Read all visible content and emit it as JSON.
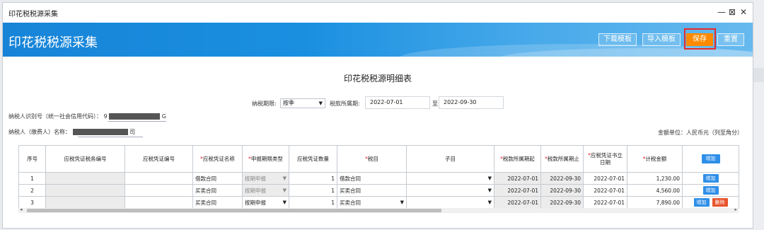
{
  "window": {
    "title": "印花税税源采集",
    "controls": {
      "minimize": "—",
      "maximize": "⊠",
      "close": "✕"
    }
  },
  "header": {
    "title": "印花税税源采集",
    "buttons": {
      "download_template": "下载模板",
      "import_template": "导入模板",
      "save": "保存",
      "reset": "重置"
    }
  },
  "form": {
    "title": "印花税税源明细表",
    "period_type_label": "纳税期限:",
    "period_type_value": "按季",
    "tax_period_label": "税款所属期:",
    "tax_period_start": "2022-07-01",
    "tax_period_to": "至",
    "tax_period_end": "2022-09-30",
    "taxpayer_id_label": "纳税人识别号（统一社会信用代码）：",
    "taxpayer_id_prefix": "9",
    "taxpayer_id_suffix": "G",
    "taxpayer_name_label": "纳税人（缴费人）名称：",
    "taxpayer_name_prefix": "",
    "taxpayer_name_suffix": "司",
    "amount_unit": "金额单位：人民币元（列至角分）"
  },
  "table": {
    "columns": [
      {
        "label": "序号",
        "required": false
      },
      {
        "label": "应税凭证税务编号",
        "required": false
      },
      {
        "label": "应税凭证编号",
        "required": false
      },
      {
        "label": "应税凭证名称",
        "required": true
      },
      {
        "label": "申报期限类型",
        "required": true
      },
      {
        "label": "应税凭证数量",
        "required": false
      },
      {
        "label": "税目",
        "required": true
      },
      {
        "label": "子目",
        "required": false
      },
      {
        "label": "税款所属期起",
        "required": true
      },
      {
        "label": "税款所属期止",
        "required": true
      },
      {
        "label": "应税凭证书立日期",
        "required": true
      },
      {
        "label": "计税金额",
        "required": true
      },
      {
        "label": "",
        "required": false
      }
    ],
    "header_add_button": "增加",
    "required_mark": "*",
    "rows": [
      {
        "index": "1",
        "tax_no": "",
        "doc_no": "",
        "name": "借款合同",
        "period_type": "按期申报",
        "qty": "1",
        "item": "借款合同",
        "sub_item": "",
        "start": "2022-07-01",
        "end": "2022-09-30",
        "sign_date": "2022-07-01",
        "amount": "1,230.00",
        "actions": [
          "增加"
        ]
      },
      {
        "index": "2",
        "tax_no": "",
        "doc_no": "",
        "name": "买卖合同",
        "period_type": "按期申报",
        "qty": "1",
        "item": "买卖合同",
        "sub_item": "",
        "start": "2022-07-01",
        "end": "2022-09-30",
        "sign_date": "2022-07-01",
        "amount": "4,560.00",
        "actions": [
          "增加"
        ]
      },
      {
        "index": "3",
        "tax_no": "",
        "doc_no": "",
        "name": "买卖合同",
        "period_type": "按期申报",
        "qty": "1",
        "item": "买卖合同",
        "sub_item": "",
        "start": "2022-07-01",
        "end": "2022-09-30",
        "sign_date": "2022-07-01",
        "amount": "7,890.00",
        "actions": [
          "增加",
          "删除"
        ]
      }
    ]
  },
  "colors": {
    "banner": "#1a8fe0",
    "save_button": "#ff8a00",
    "highlight": "#e52b2b",
    "add_button": "#2f8fe8",
    "delete_button": "#e8542d",
    "required": "#e02020"
  },
  "icons": {
    "dropdown": "chevron-down-icon"
  }
}
